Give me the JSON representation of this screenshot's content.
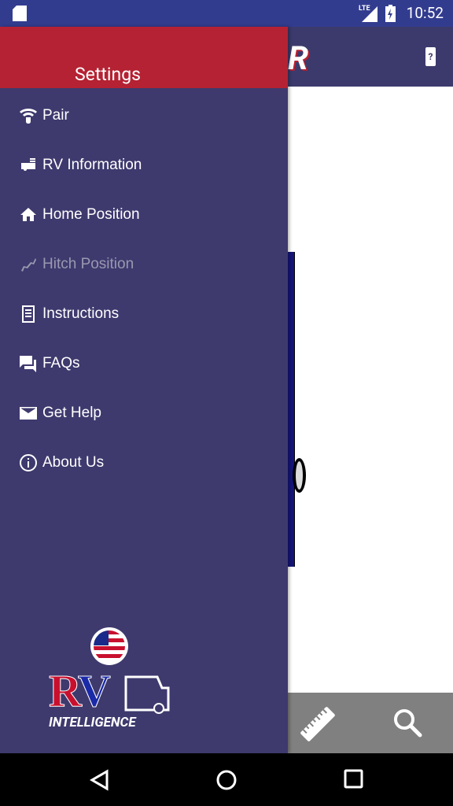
{
  "status_bar": {
    "time": "10:52",
    "network": "LTE",
    "icons": [
      "sd-card-icon",
      "signal-icon",
      "battery-charging-icon"
    ]
  },
  "drawer": {
    "title": "Settings",
    "items": [
      {
        "label": "Pair",
        "icon": "wifi-pair-icon",
        "enabled": true
      },
      {
        "label": "RV Information",
        "icon": "rv-icon",
        "enabled": true
      },
      {
        "label": "Home Position",
        "icon": "home-icon",
        "enabled": true
      },
      {
        "label": "Hitch Position",
        "icon": "hitch-icon",
        "enabled": false
      },
      {
        "label": "Instructions",
        "icon": "document-icon",
        "enabled": true
      },
      {
        "label": "FAQs",
        "icon": "chat-icon",
        "enabled": true
      },
      {
        "label": "Get Help",
        "icon": "mail-icon",
        "enabled": true
      },
      {
        "label": "About Us",
        "icon": "info-icon",
        "enabled": true
      }
    ],
    "logo": {
      "text": "RV",
      "subtext": "INTELLIGENCE"
    }
  },
  "appbar": {
    "battery_status": "?"
  },
  "bottom_bar": {
    "icons": [
      "ruler-icon",
      "search-icon"
    ]
  },
  "colors": {
    "status": "#323c8f",
    "drawer": "#3e3a6e",
    "header": "#b52233",
    "bottom": "#808080"
  }
}
